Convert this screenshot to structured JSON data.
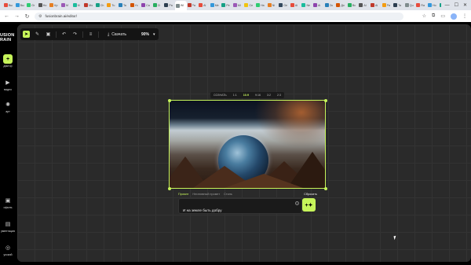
{
  "browser": {
    "tabs": [
      {
        "label": "Вы",
        "color": "#e74c3c"
      },
      {
        "label": "Вы",
        "color": "#3498db"
      },
      {
        "label": "Gr",
        "color": "#2ecc71"
      },
      {
        "label": "Ho",
        "color": "#555555"
      },
      {
        "label": "Кр",
        "color": "#e67e22"
      },
      {
        "label": "M",
        "color": "#9b59b6"
      },
      {
        "label": "M",
        "color": "#1abc9c"
      },
      {
        "label": "Мо",
        "color": "#c0392b"
      },
      {
        "label": "Ch",
        "color": "#16a085"
      },
      {
        "label": "Tu",
        "color": "#f39c12"
      },
      {
        "label": "Ta",
        "color": "#2980b9"
      },
      {
        "label": "Yc",
        "color": "#d35400"
      },
      {
        "label": "Ca",
        "color": "#8e44ad"
      },
      {
        "label": "Ci",
        "color": "#27ae60"
      },
      {
        "label": "Pa",
        "color": "#2c3e50"
      },
      {
        "label": "Wi",
        "color": "#7f8c8d"
      },
      {
        "label": "Pa",
        "color": "#c0392b"
      },
      {
        "label": "Al",
        "color": "#e74c3c"
      },
      {
        "label": "Me",
        "color": "#3498db"
      },
      {
        "label": "Pe",
        "color": "#16a085"
      },
      {
        "label": "Mi",
        "color": "#9b59b6"
      },
      {
        "label": "Ce",
        "color": "#f1c40f"
      },
      {
        "label": "Ha",
        "color": "#2ecc71"
      },
      {
        "label": "Ni",
        "color": "#e67e22"
      },
      {
        "label": "Ge",
        "color": "#34495e"
      },
      {
        "label": "Ai",
        "color": "#e74c3c"
      },
      {
        "label": "Ne",
        "color": "#1abc9c"
      },
      {
        "label": "Ai",
        "color": "#8e44ad"
      },
      {
        "label": "Oc",
        "color": "#2980b9"
      },
      {
        "label": "Ди",
        "color": "#d35400"
      },
      {
        "label": "Вс",
        "color": "#27ae60"
      },
      {
        "label": "Ai",
        "color": "#555555"
      },
      {
        "label": "Ai",
        "color": "#c0392b"
      },
      {
        "label": "Pa",
        "color": "#f39c12"
      },
      {
        "label": "Ta",
        "color": "#2c3e50"
      },
      {
        "label": "Qu",
        "color": "#7f8c8d"
      },
      {
        "label": "Ra",
        "color": "#e74c3c"
      },
      {
        "label": "Ho",
        "color": "#3498db"
      },
      {
        "label": "Pe",
        "color": "#16a085"
      }
    ],
    "url": "fusionbrain.ai/editor/"
  },
  "sidebar": {
    "logo_line1": "USION",
    "logo_line2": "RAIN",
    "items": [
      {
        "label": "дактор",
        "icon": "editor-icon",
        "glyph": "+"
      },
      {
        "label": "видео",
        "icon": "video-icon",
        "glyph": "▶"
      },
      {
        "label": "арт",
        "icon": "art-icon",
        "glyph": "✺"
      },
      {
        "label": "офиль",
        "icon": "profile-icon",
        "glyph": "▣"
      },
      {
        "label": "ументация",
        "icon": "docs-icon",
        "glyph": "▤"
      },
      {
        "label": "усский",
        "icon": "language-icon",
        "glyph": "◎"
      }
    ]
  },
  "toolbar": {
    "download_label": "Скачать",
    "zoom": "90%"
  },
  "ratios": [
    "СОЗНАТЬ",
    "1:1",
    "16:9",
    "9:16",
    "3:2",
    "2:3"
  ],
  "prompt": {
    "tabs": [
      "Промпт",
      "Негативный промпт",
      "Стиль"
    ],
    "reset_label": "Сбросить",
    "text": "И на земле быть добру"
  },
  "colors": {
    "accent": "#c6f45a",
    "canvas": "#2a2a2a"
  }
}
